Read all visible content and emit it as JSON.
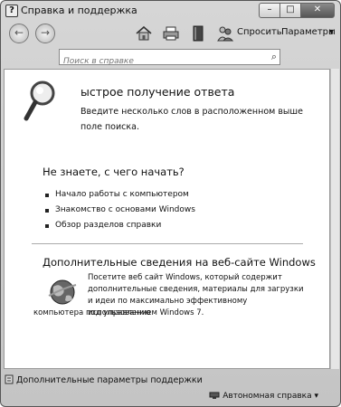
{
  "window": {
    "title": "Справка и поддержка",
    "controls": {
      "minimize": "–",
      "maximize": "□",
      "close": "✕"
    }
  },
  "toolbar": {
    "back_icon": "←",
    "forward_icon": "→",
    "ask_label": "Спросить",
    "options_label": "Параметры",
    "dropdown_icon": "▾"
  },
  "search": {
    "placeholder": "Поиск в справке",
    "icon": "⌕"
  },
  "main": {
    "quick_heading": "ыстрое получение ответа",
    "quick_text": "Введите несколько слов в расположенном выше поле поиска.",
    "start_heading": "Не знаете, с чего начать?",
    "links": [
      "Начало работы с компьютером",
      "Знакомство с основами Windows",
      "Обзор разделов справки"
    ],
    "web_heading": "Дополнительные сведения на веб-сайте Windows",
    "web_text_1": "Посетите веб сайт Windows, который содержит дополнительные сведения, материалы для загрузки и идеи по максимально эффективному использованию",
    "web_text_2": "компьютера под управлением Windows 7."
  },
  "footer": {
    "support_label": "Дополнительные параметры поддержки",
    "offline_label": "Автономная справка",
    "dropdown_icon": "▾"
  }
}
